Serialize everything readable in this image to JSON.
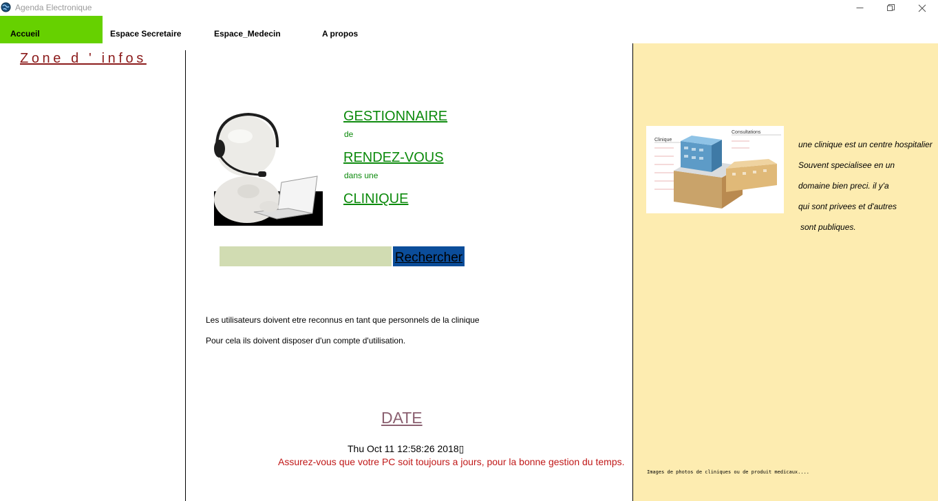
{
  "window": {
    "title": "Agenda Electronique",
    "controls": {
      "minimize": "—",
      "maximize": "❐",
      "close": "✕"
    }
  },
  "menu": [
    {
      "label": "Accueil",
      "active": true
    },
    {
      "label": "Espace Secretaire"
    },
    {
      "label": "Espace_Medecin"
    },
    {
      "label": "A propos"
    }
  ],
  "left_panel": {
    "heading": "Zone d ' infos"
  },
  "hero": {
    "line1": "GESTIONNAIRE",
    "line2": "de",
    "line3": "RENDEZ-VOUS",
    "line4": "dans une",
    "line5": "CLINIQUE",
    "avatar_icon": "headset-user-laptop-icon"
  },
  "search": {
    "value": "",
    "placeholder": "",
    "button_label": "Rechercher"
  },
  "info": {
    "line1": "Les utilisateurs doivent etre reconnus en tant que personnels de la clinique",
    "line2": "Pour cela ils doivent disposer d'un compte d'utilisation."
  },
  "date": {
    "title": "DATE",
    "value": "Thu Oct 11 12:58:26 2018▯",
    "warning": "Assurez-vous que votre PC soit toujours a jours, pour la bonne gestion du temps."
  },
  "right_panel": {
    "image_labels": {
      "left": "Clinique",
      "right": "Consultations"
    },
    "text_lines": [
      "une clinique est un centre hospitalier",
      "Souvent specialisee en un",
      "domaine bien preci. il y'a",
      "qui sont privees et d'autres",
      " sont publiques."
    ],
    "footer": "Images de photos de cliniques ou de produit medicaux...."
  },
  "colors": {
    "accent_menu": "#66d100",
    "green_text": "#0c8a0c",
    "panel_bg": "#fdecb0",
    "search_bg": "#d1dcb2",
    "search_btn": "#0b4d9a",
    "warning": "#c01818"
  }
}
